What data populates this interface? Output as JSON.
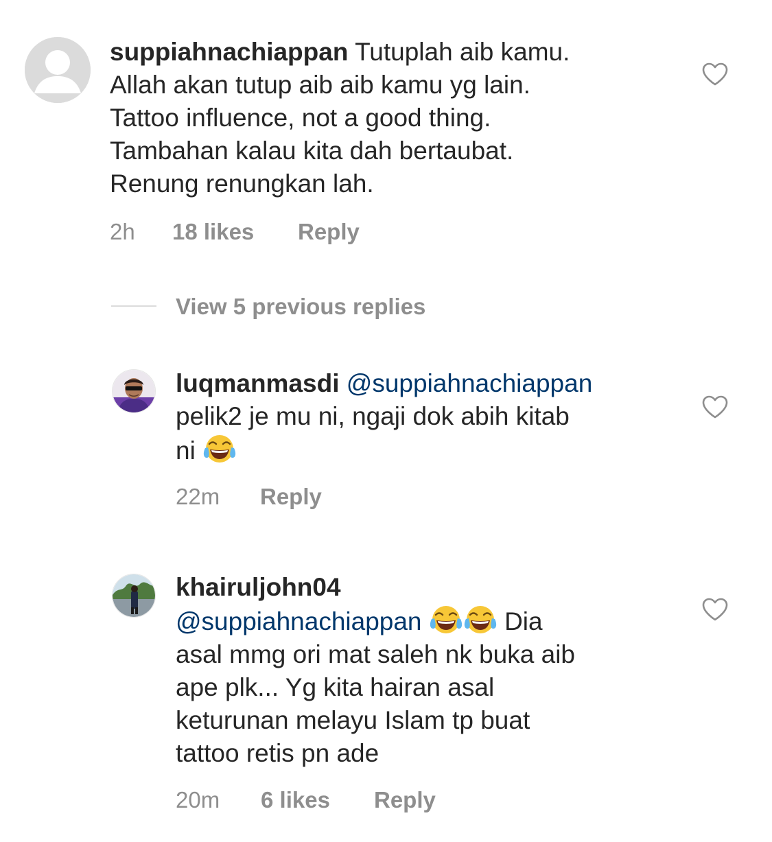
{
  "comments": [
    {
      "username": "suppiahnachiappan",
      "lines": [
        "Tutuplah aib kamu.",
        "Allah akan tutup aib aib kamu yg lain.",
        "Tattoo influence, not a good thing.",
        "Tambahan kalau kita dah bertaubat.",
        "Renung renungkan lah."
      ],
      "time": "2h",
      "likes": "18 likes",
      "reply": "Reply"
    },
    {
      "username": "luqmanmasdi",
      "mention": "@suppiahnachiappan",
      "line2": "pelik2 je mu ni, ngaji dok abih kitab",
      "line3": "ni",
      "emoji": "face-with-tears-of-joy",
      "time": "22m",
      "reply": "Reply"
    },
    {
      "username": "khairuljohn04",
      "mention": "@suppiahnachiappan",
      "after_emoji": "Dia",
      "lines": [
        "asal mmg ori mat saleh nk buka aib",
        "ape plk... Yg kita hairan asal",
        "keturunan melayu Islam tp buat",
        "tattoo retis pn ade"
      ],
      "emoji": "face-with-tears-of-joy",
      "time": "20m",
      "likes": "6 likes",
      "reply": "Reply"
    }
  ],
  "view_replies": "View 5 previous replies",
  "icons": {
    "like": "heart-outline-icon",
    "avatar_default": "default-avatar-icon"
  },
  "colors": {
    "text": "#262626",
    "secondary": "#8e8e8e",
    "mention": "#00376b"
  }
}
